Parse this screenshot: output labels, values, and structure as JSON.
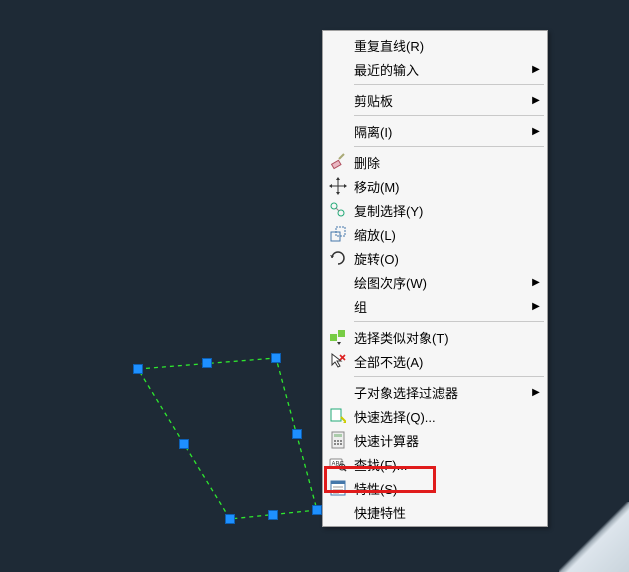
{
  "menu": {
    "repeat_line": "重复直线(R)",
    "recent_input": "最近的输入",
    "clipboard": "剪贴板",
    "isolate": "隔离(I)",
    "delete": "删除",
    "move": "移动(M)",
    "copy_selection": "复制选择(Y)",
    "scale": "缩放(L)",
    "rotate": "旋转(O)",
    "draw_order": "绘图次序(W)",
    "group": "组",
    "select_similar": "选择类似对象(T)",
    "deselect_all": "全部不选(A)",
    "subobject_filter": "子对象选择过滤器",
    "quick_select": "快速选择(Q)...",
    "quick_calc": "快速计算器",
    "find": "查找(F)...",
    "properties": "特性(S)",
    "quick_properties": "快捷特性"
  },
  "selection": {
    "object": "polyline-quadrilateral",
    "grips": 8
  }
}
